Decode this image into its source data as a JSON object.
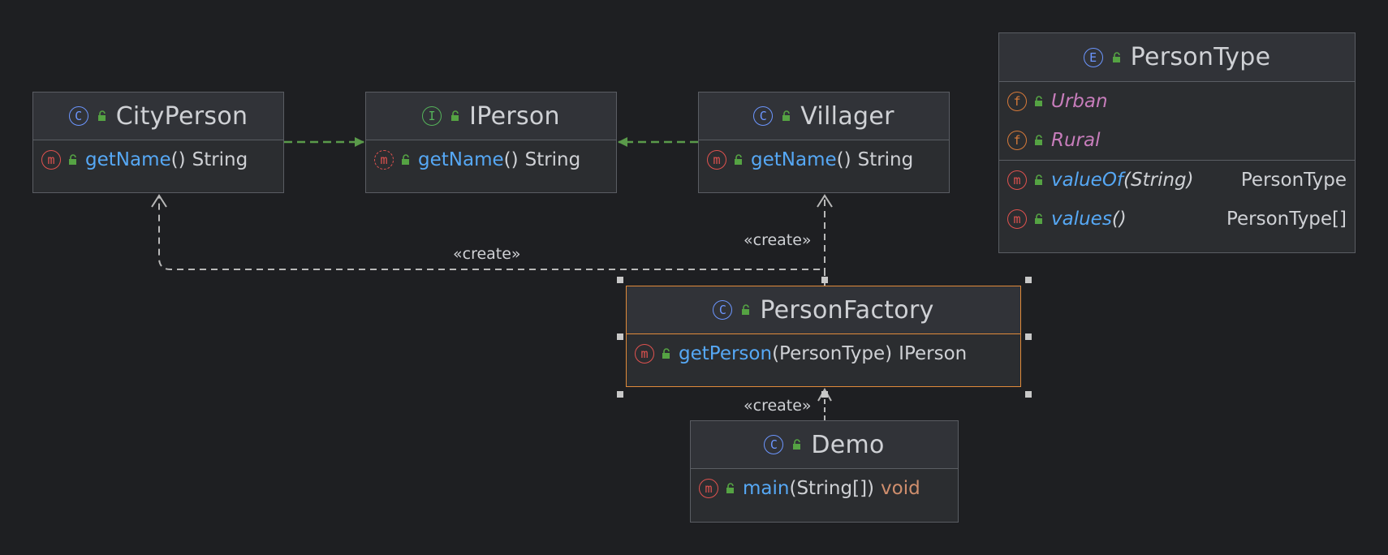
{
  "nodes": {
    "cityperson": {
      "title": "CityPerson",
      "kind": "class",
      "methods": [
        {
          "name": "getName",
          "open": "(",
          "close": ")",
          "return": "String"
        }
      ]
    },
    "iperson": {
      "title": "IPerson",
      "kind": "interface",
      "methods": [
        {
          "name": "getName",
          "open": "(",
          "close": ")",
          "return": "String"
        }
      ]
    },
    "villager": {
      "title": "Villager",
      "kind": "class",
      "methods": [
        {
          "name": "getName",
          "open": "(",
          "close": ")",
          "return": "String"
        }
      ]
    },
    "persontype": {
      "title": "PersonType",
      "kind": "enum",
      "fields": [
        "Urban",
        "Rural"
      ],
      "methods": [
        {
          "name": "valueOf",
          "open": "(",
          "param": "String",
          "close": ")",
          "return": "PersonType"
        },
        {
          "name": "values",
          "open": "(",
          "close": ")",
          "return": "PersonType[]"
        }
      ]
    },
    "personfactory": {
      "title": "PersonFactory",
      "kind": "class",
      "methods": [
        {
          "name": "getPerson",
          "open": "(",
          "param": "PersonType",
          "close": ")",
          "return": "IPerson"
        }
      ]
    },
    "demo": {
      "title": "Demo",
      "kind": "class",
      "methods": [
        {
          "name": "main",
          "open": "(",
          "param": "String[]",
          "close": ")",
          "return": "void"
        }
      ]
    }
  },
  "badges": {
    "class": "C",
    "interface": "I",
    "enum": "E",
    "method": "m",
    "field": "f"
  },
  "edges": {
    "create_cityperson": "«create»",
    "create_villager": "«create»",
    "create_factory": "«create»"
  },
  "colors": {
    "background": "#1e1f22",
    "node_bg": "#2b2d30",
    "border": "#5a5d63",
    "selected_border": "#e08a3a",
    "realization_arrow": "#5a9a4a",
    "dependency_arrow": "#b8b8b8",
    "method_name": "#56a8f5",
    "field_name": "#c77dbb",
    "void_keyword": "#cf8e6d",
    "lock_icon": "#55a343"
  }
}
